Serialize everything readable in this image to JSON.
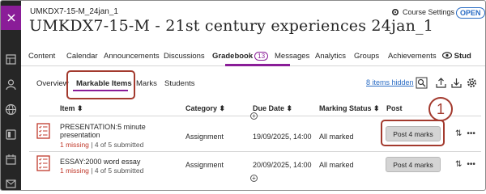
{
  "header": {
    "course_code": "UMKDX7-15-M_24jan_1",
    "course_title": "UMKDX7-15-M - 21st century experiences 24jan_1",
    "course_settings": "Course Settings",
    "status_badge": "OPEN"
  },
  "tabs": [
    {
      "label": "Content"
    },
    {
      "label": "Calendar"
    },
    {
      "label": "Announcements"
    },
    {
      "label": "Discussions"
    },
    {
      "label": "Gradebook",
      "badge": "13",
      "active": true
    },
    {
      "label": "Messages"
    },
    {
      "label": "Analytics"
    },
    {
      "label": "Groups"
    },
    {
      "label": "Achievements"
    },
    {
      "label": "Stud"
    }
  ],
  "subtabs": [
    {
      "label": "Overview"
    },
    {
      "label": "Markable Items",
      "active": true
    },
    {
      "label": "Marks"
    },
    {
      "label": "Students"
    }
  ],
  "hidden_link": "8 items hidden",
  "table": {
    "headers": {
      "item": "Item",
      "category": "Category",
      "due_date": "Due Date",
      "marking_status": "Marking Status",
      "post": "Post"
    },
    "rows": [
      {
        "title_line1": "PRESENTATION:5 minute",
        "title_line2": "presentation",
        "missing": "1 missing",
        "submitted": " | 4 of 5 submitted",
        "category": "Assignment",
        "due_date": "19/09/2025, 14:00",
        "marking_status": "All marked",
        "post_label": "Post 4 marks"
      },
      {
        "title_line1": "ESSAY:2000 word essay",
        "missing": "1 missing",
        "submitted": " | 4 of 5 submitted",
        "category": "Assignment",
        "due_date": "20/09/2025, 14:00",
        "marking_status": "All marked",
        "post_label": "Post 4 marks"
      }
    ]
  },
  "annotation": {
    "number": "1"
  },
  "colors": {
    "accent": "#8a1d98",
    "link": "#2a6cc4",
    "missing": "#c0392b",
    "callout": "#a33a2e"
  }
}
